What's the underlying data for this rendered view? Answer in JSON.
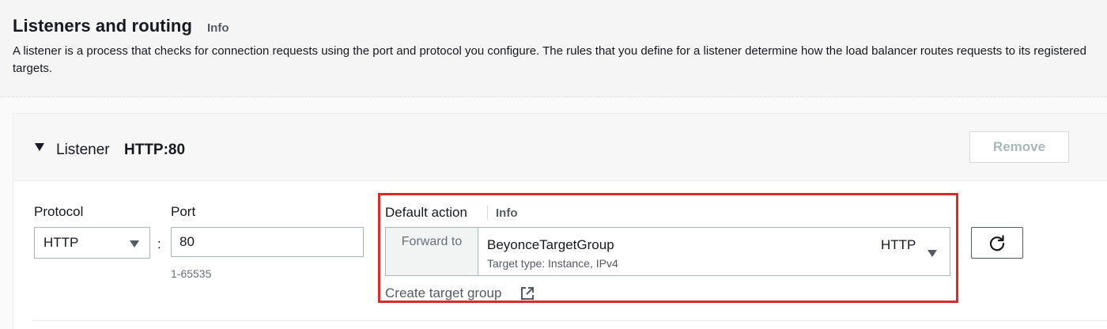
{
  "section": {
    "title": "Listeners and routing",
    "info": "Info",
    "description": "A listener is a process that checks for connection requests using the port and protocol you configure. The rules that you define for a listener determine how the load balancer routes requests to its registered targets."
  },
  "listener": {
    "label": "Listener",
    "name": "HTTP:80",
    "remove_label": "Remove",
    "protocol": {
      "label": "Protocol",
      "value": "HTTP"
    },
    "separator": ":",
    "port": {
      "label": "Port",
      "value": "80",
      "hint": "1-65535"
    },
    "default_action": {
      "label": "Default action",
      "info": "Info",
      "forward_label": "Forward to",
      "target_group_name": "BeyonceTargetGroup",
      "target_group_detail": "Target type: Instance, IPv4",
      "target_group_protocol": "HTTP",
      "create_link": "Create target group"
    }
  },
  "icons": {
    "collapse": "caret-down-icon",
    "select": "chevron-down-icon",
    "external": "external-link-icon",
    "refresh": "refresh-icon"
  },
  "colors": {
    "highlight_border": "#d92b2b",
    "disabled_text": "#aab7b8",
    "secondary_text": "#545b64"
  }
}
